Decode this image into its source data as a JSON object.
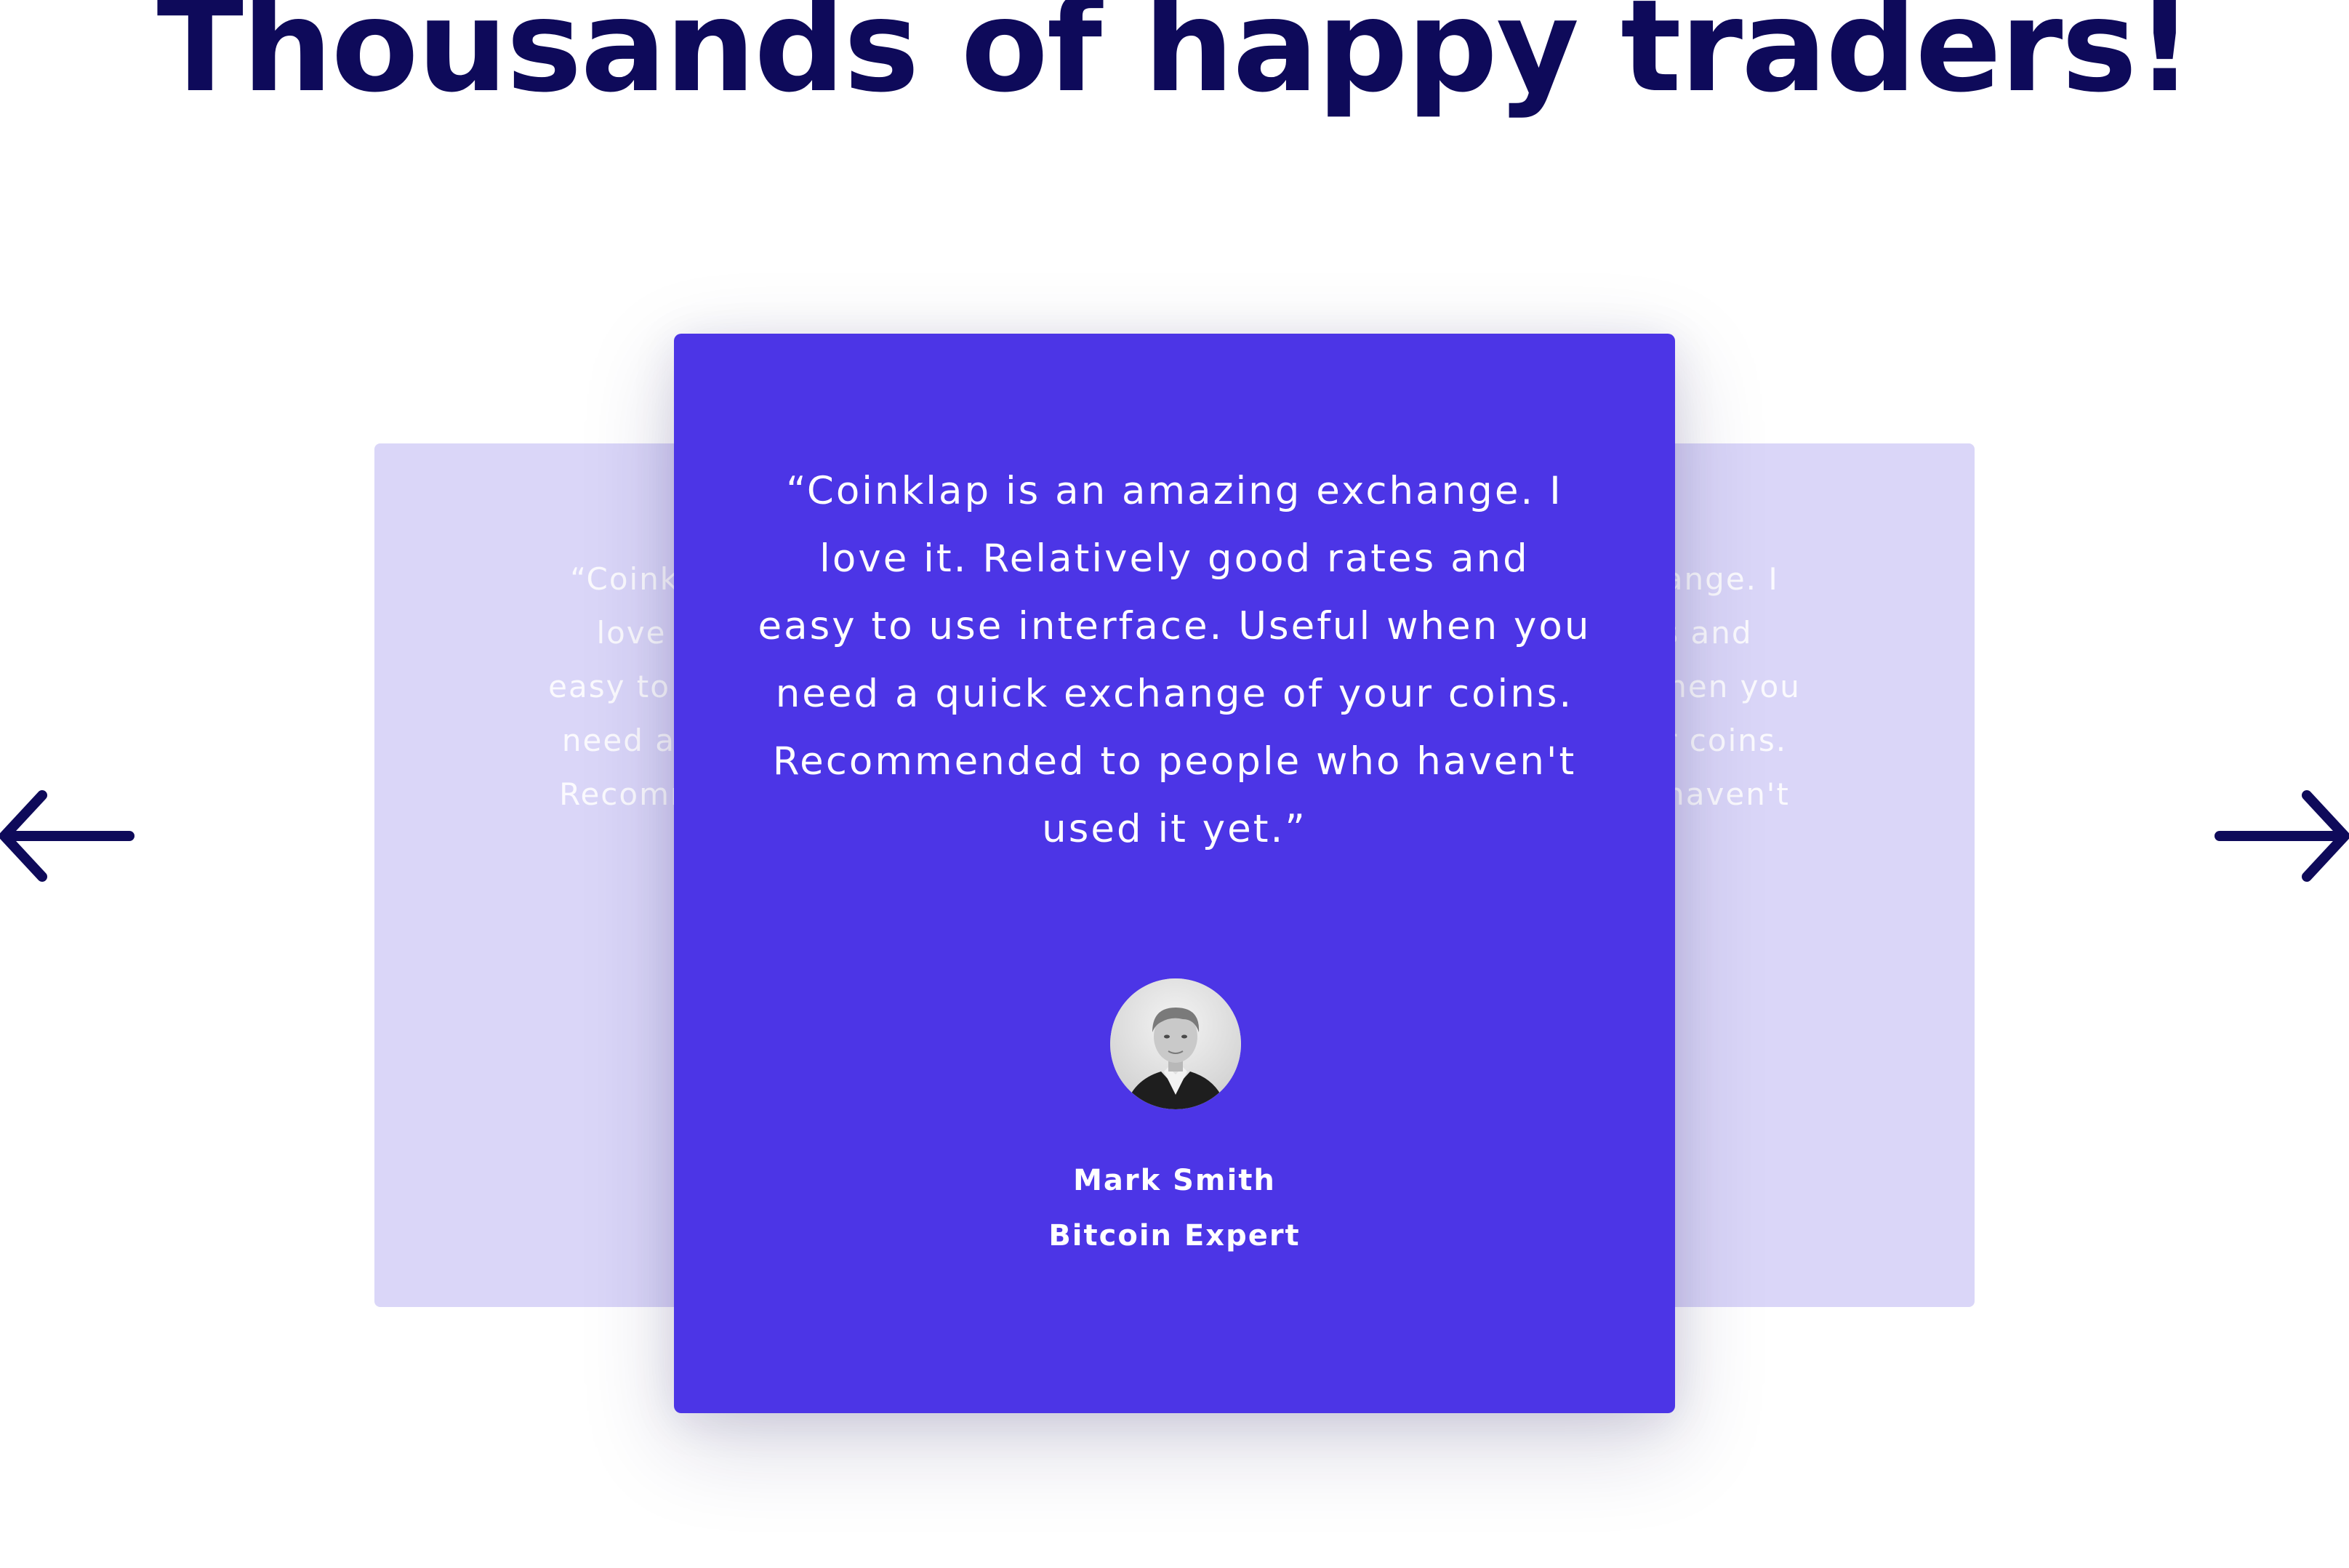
{
  "heading": "Thousands of happy traders!",
  "colors": {
    "heading": "#0e0a5a",
    "active_card": "#4c35e6",
    "inactive_card": "#dad6f8",
    "text_on_card": "#ffffff"
  },
  "carousel": {
    "prev_icon": "arrow-left-icon",
    "next_icon": "arrow-right-icon",
    "active": {
      "quote_lines": [
        "“Coinklap is an amazing exchange. I",
        "love it. Relatively good rates and",
        "easy to use interface. Useful when you",
        "need a quick exchange of your coins.",
        "Recommended to people who haven't",
        "used it yet.”"
      ],
      "avatar_icon": "person-photo",
      "author_name": "Mark Smith",
      "author_role": "Bitcoin Expert"
    },
    "left_card": {
      "quote_lines": [
        "“Coinklap is an amazing exchange. I",
        "love it. Relatively good rates and",
        "easy to use interface. Useful when you",
        "need a quick exchange of your coins.",
        "Recommended to people who haven't"
      ]
    },
    "right_card": {
      "quote_lines": [
        "“Coinklap is an amazing exchange. I",
        "love it. Relatively good rates and",
        "easy to use interface. Useful when you",
        "need a quick exchange of your coins.",
        "Recommended to people who haven't"
      ]
    }
  }
}
